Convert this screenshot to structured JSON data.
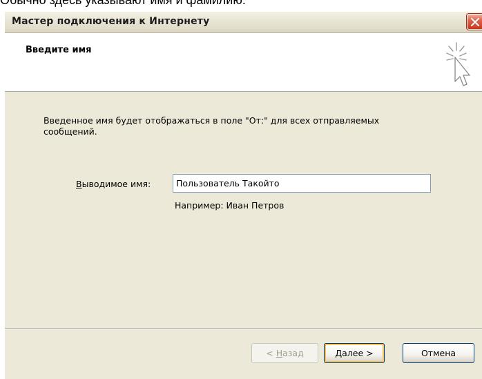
{
  "caption": "Обычно здесь указывают имя и фамилию.",
  "window": {
    "title": "Мастер подключения к Интернету",
    "close_icon": "close-icon"
  },
  "header": {
    "title": "Введите имя",
    "icon": "wizard-sparkle-cursor-icon"
  },
  "body": {
    "description": "Введенное имя будет отображаться в поле \"От:\" для всех отправляемых сообщений.",
    "field_label_accel": "В",
    "field_label_rest": "ыводимое имя:",
    "display_name_value": "Пользователь Такойто",
    "example": "Например: Иван Петров"
  },
  "buttons": {
    "back_prefix": "< ",
    "back_accel": "Н",
    "back_rest": "азад",
    "next_accel": "Д",
    "next_rest": "алее >",
    "cancel": "Отмена"
  },
  "colors": {
    "window_frame": "#0a54e6",
    "dialog_face": "#ece9d8",
    "close_button": "#e06048",
    "focus_outline": "#f5c35f"
  }
}
